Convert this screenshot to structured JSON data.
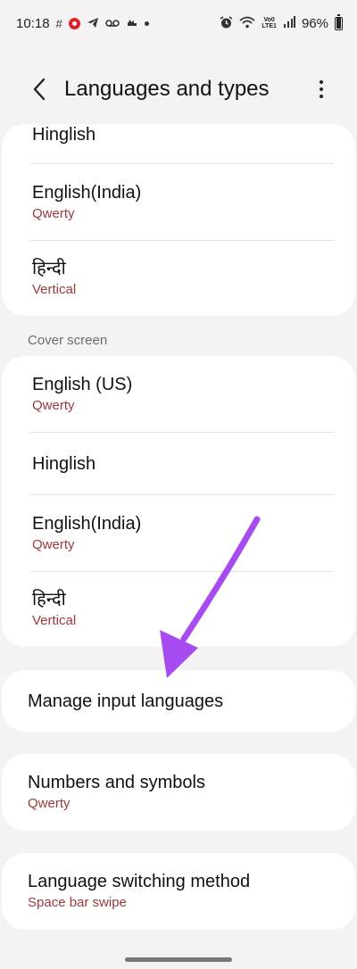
{
  "status_bar": {
    "time": "10:18",
    "volte": "Vo0\nLTE1",
    "battery": "96%"
  },
  "header": {
    "title": "Languages and types"
  },
  "main_keyboard_languages": [
    {
      "title": "Hinglish",
      "sub": ""
    },
    {
      "title": "English(India)",
      "sub": "Qwerty"
    },
    {
      "title": "हिन्दी",
      "sub": "Vertical"
    }
  ],
  "cover_screen": {
    "label": "Cover screen",
    "languages": [
      {
        "title": "English (US)",
        "sub": "Qwerty"
      },
      {
        "title": "Hinglish",
        "sub": ""
      },
      {
        "title": "English(India)",
        "sub": "Qwerty"
      },
      {
        "title": "हिन्दी",
        "sub": "Vertical"
      }
    ]
  },
  "manage_input_languages": {
    "title": "Manage input languages"
  },
  "numbers_and_symbols": {
    "title": "Numbers and symbols",
    "sub": "Qwerty"
  },
  "language_switching": {
    "title": "Language switching method",
    "sub": "Space bar swipe"
  },
  "colors": {
    "background": "#f4f2f2",
    "card": "#ffffff",
    "subtitle": "#9a3a3a",
    "annotation_arrow": "#a64bf0"
  }
}
